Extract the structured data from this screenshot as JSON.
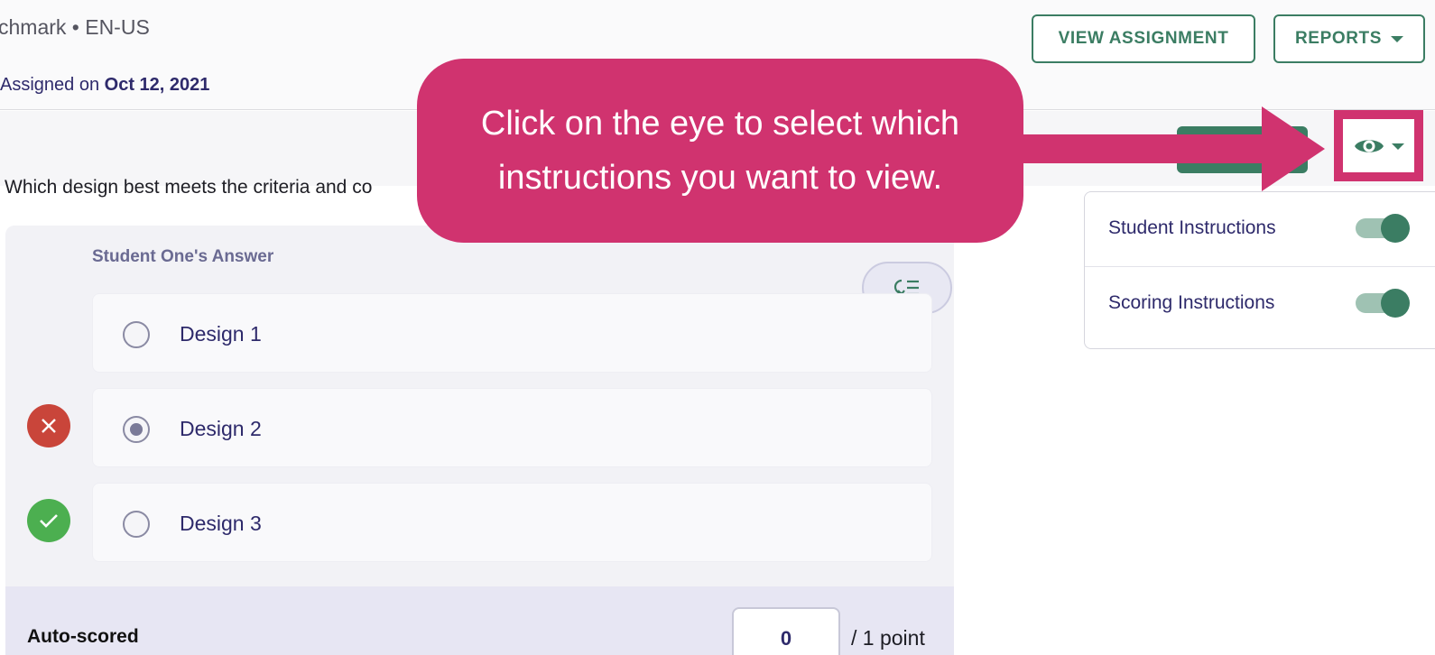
{
  "header": {
    "subtitle": "chmark • EN-US",
    "assigned_prefix": "Assigned on ",
    "assigned_date": "Oct 12, 2021",
    "view_assignment_label": "VIEW ASSIGNMENT",
    "reports_label": "REPORTS"
  },
  "question": {
    "text": "Which design best meets the criteria and co"
  },
  "answer": {
    "heading": "Student One's Answer",
    "options": [
      {
        "label": "Design 1",
        "selected": false,
        "mark": "none"
      },
      {
        "label": "Design 2",
        "selected": true,
        "mark": "incorrect"
      },
      {
        "label": "Design 3",
        "selected": false,
        "mark": "correct"
      }
    ]
  },
  "score": {
    "label": "Auto-scored",
    "value": "0",
    "total": "/ 1 point"
  },
  "instructions_menu": {
    "items": [
      {
        "label": "Student Instructions",
        "enabled": true
      },
      {
        "label": "Scoring Instructions",
        "enabled": true
      }
    ]
  },
  "callout": {
    "text": "Click on the eye to select which instructions you want to view."
  },
  "icons": {
    "eye": "eye-icon",
    "expand": "collapse-list-icon",
    "incorrect": "close-icon",
    "correct": "check-icon"
  },
  "colors": {
    "brand_green": "#3b7d63",
    "callout_pink": "#d0336f",
    "text_navy": "#2e2a6b",
    "incorrect_red": "#c9453a",
    "correct_green": "#4caf50"
  }
}
